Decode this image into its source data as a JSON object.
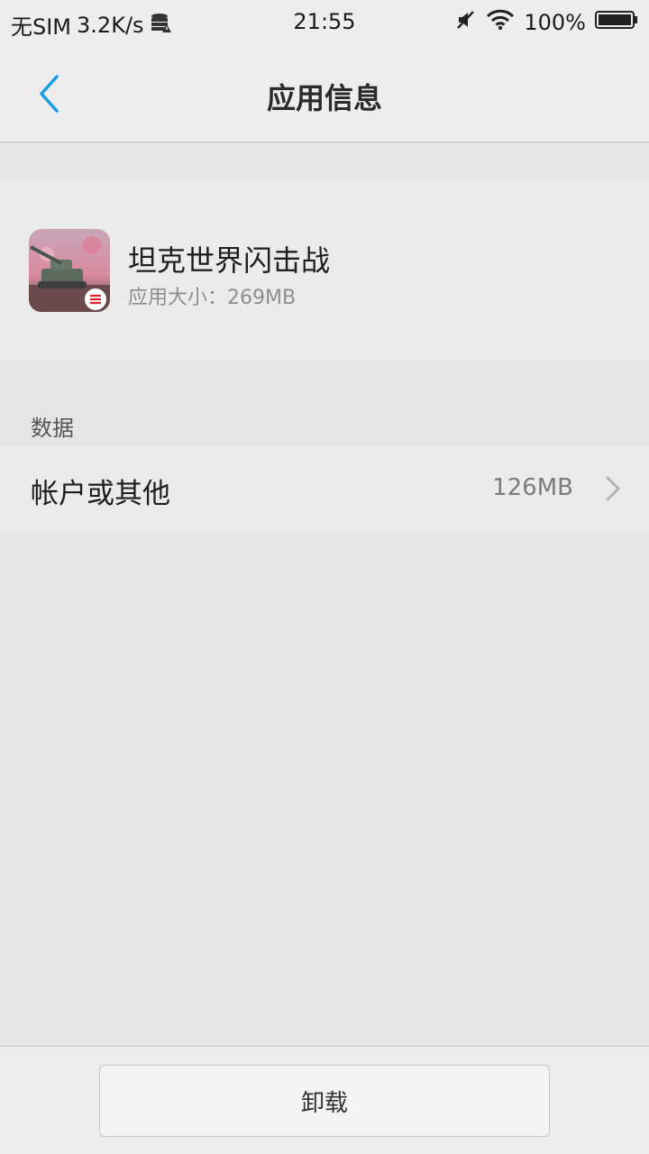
{
  "status_bar": {
    "carrier": "无SIM",
    "speed": "3.2K/s",
    "time": "21:55",
    "battery": "100%"
  },
  "header": {
    "title": "应用信息",
    "back_icon": "chevron-left-icon"
  },
  "app": {
    "name": "坦克世界闪击战",
    "size_text": "应用大小：269MB"
  },
  "data_section": {
    "label": "数据",
    "rows": [
      {
        "label": "帐户或其他",
        "value": "126MB"
      }
    ]
  },
  "footer": {
    "uninstall_label": "卸载"
  },
  "colors": {
    "accent": "#1a9be6",
    "background": "#e5e5e5",
    "card": "#ebebeb"
  }
}
